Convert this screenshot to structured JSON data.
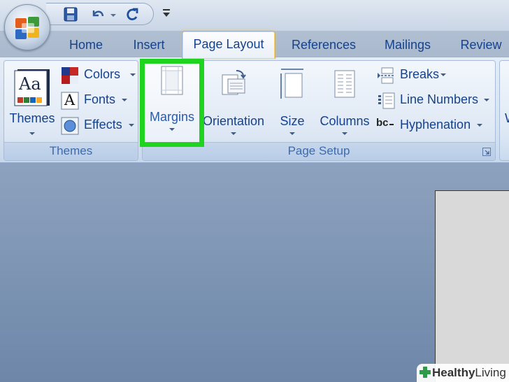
{
  "tabs": [
    "Home",
    "Insert",
    "Page Layout",
    "References",
    "Mailings",
    "Review"
  ],
  "active_tab": "Page Layout",
  "themes_group": {
    "label": "Themes",
    "themes_button": "Themes",
    "colors": "Colors",
    "fonts": "Fonts",
    "effects": "Effects",
    "theme_icon_text": "Aa",
    "fonts_icon_text": "A"
  },
  "page_setup_group": {
    "label": "Page Setup",
    "margins": "Margins",
    "orientation": "Orientation",
    "size": "Size",
    "columns": "Columns",
    "breaks": "Breaks",
    "line_numbers": "Line Numbers",
    "hyphenation": "Hyphenation",
    "hyphenation_icon_text": "bc",
    "cut_off_label": "W"
  },
  "watermark": {
    "bold": "Healthy",
    "light": "Living"
  },
  "colors": {
    "highlight": "#1ed41e",
    "ribbon_text": "#15428b",
    "group_label": "#3e6aaa"
  }
}
